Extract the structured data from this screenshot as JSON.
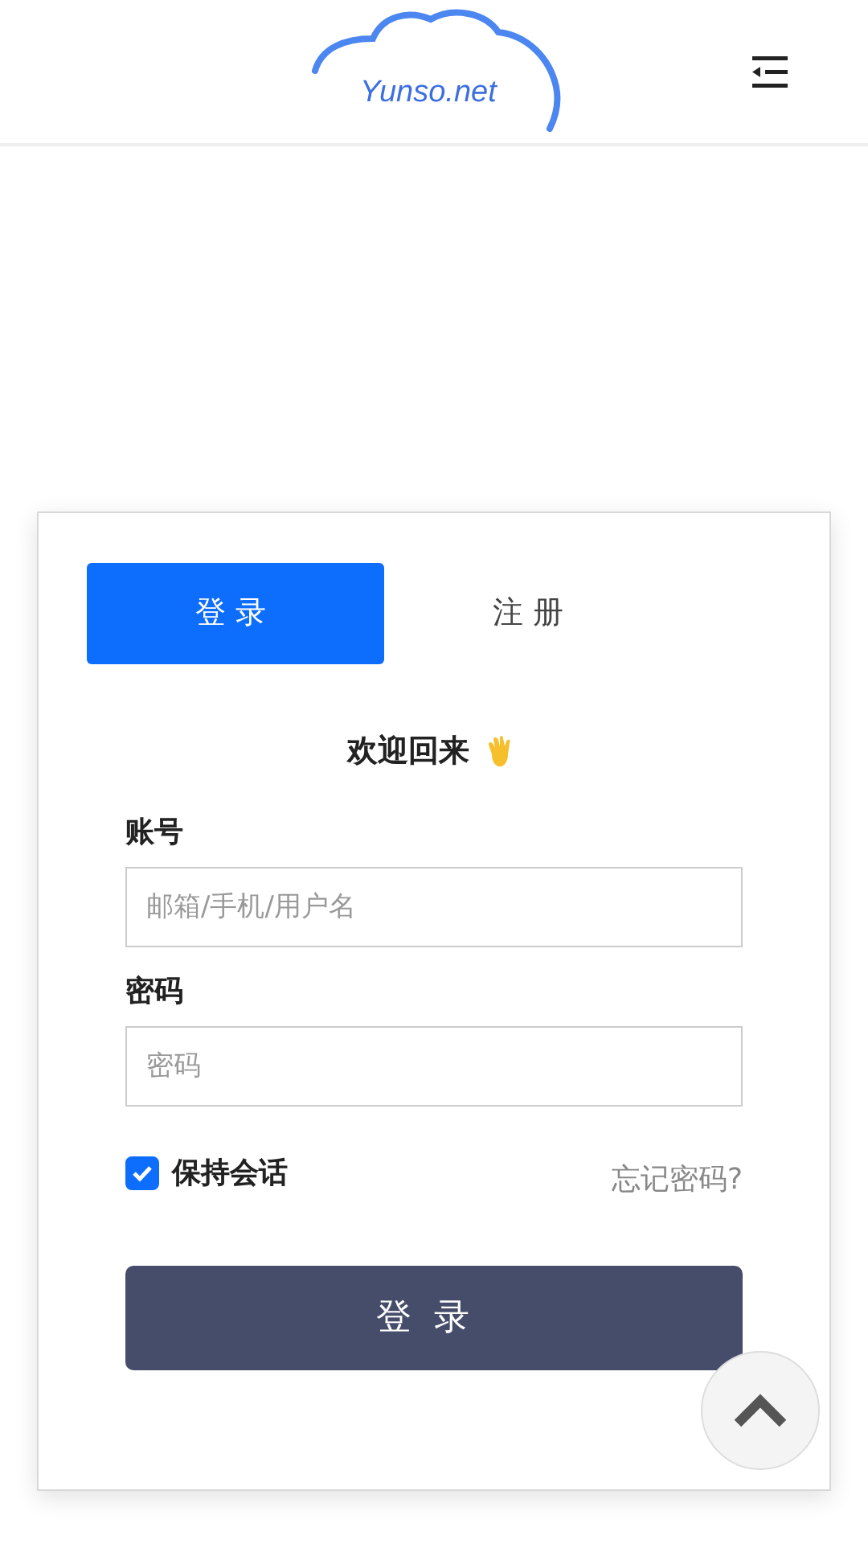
{
  "header": {
    "logo": "Yunso.net"
  },
  "tabs": [
    {
      "label": "登录",
      "selected": true
    },
    {
      "label": "注册",
      "selected": false
    }
  ],
  "welcome": "欢迎回来",
  "fields": [
    {
      "label": "账号",
      "placeholder": "邮箱/手机/用户名"
    },
    {
      "label": "密码",
      "placeholder": "密码"
    }
  ],
  "remember": {
    "label": "保持会话",
    "checked": true
  },
  "forgot_link": "忘记密码?",
  "submit": "登录"
}
